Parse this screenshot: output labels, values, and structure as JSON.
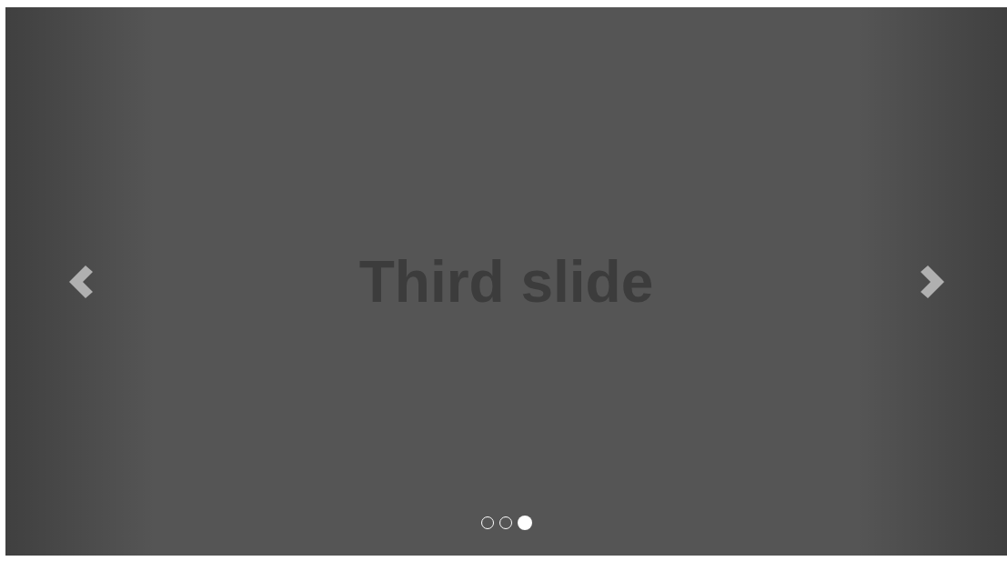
{
  "slide": {
    "caption": "Third slide"
  },
  "indicators": [
    {
      "selected": false
    },
    {
      "selected": false
    },
    {
      "selected": true
    }
  ]
}
